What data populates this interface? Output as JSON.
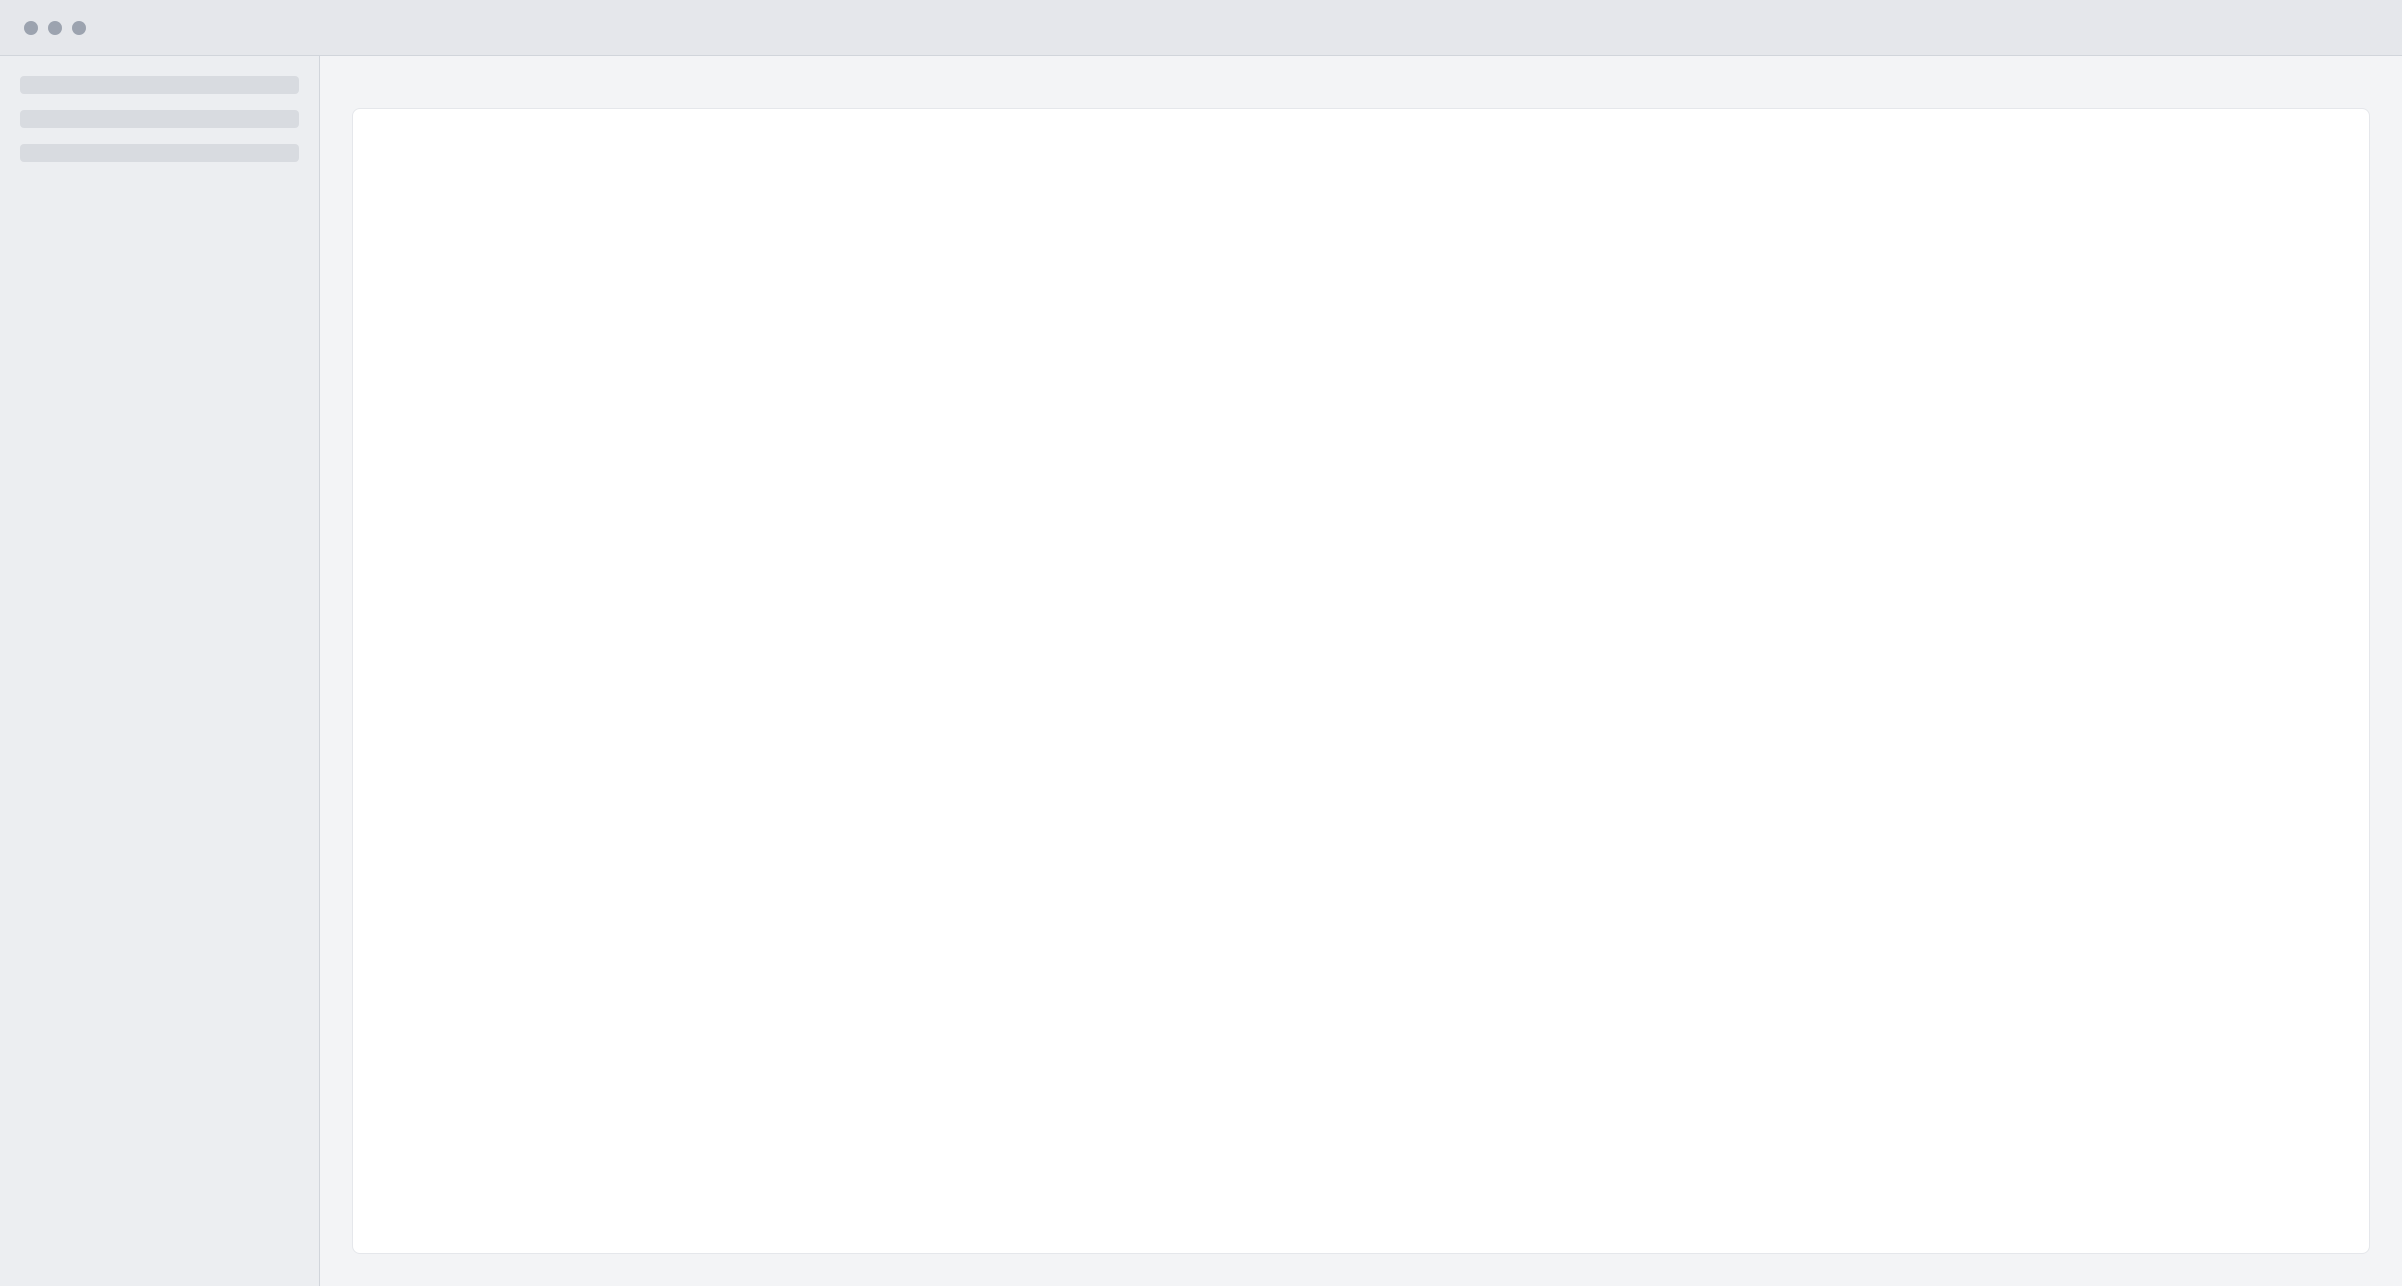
{
  "window": {
    "title": ""
  },
  "content": {
    "notice": ""
  }
}
